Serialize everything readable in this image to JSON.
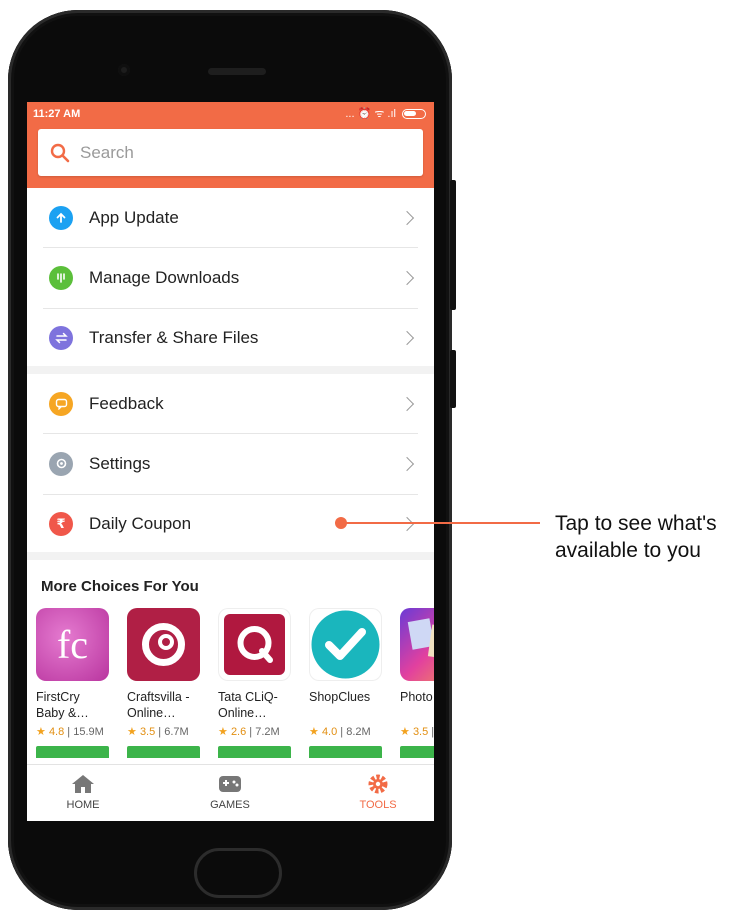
{
  "status_bar": {
    "time": "11:27 AM",
    "icons": "... ⏰ ᯤ .ıl"
  },
  "search": {
    "placeholder": "Search"
  },
  "menu_group_1": [
    {
      "label": "App Update",
      "icon": "arrow-up-icon",
      "color": "#1ba1f2"
    },
    {
      "label": "Manage Downloads",
      "icon": "download-icon",
      "color": "#5bbf3a"
    },
    {
      "label": "Transfer & Share Files",
      "icon": "transfer-icon",
      "color": "#7e73dd"
    }
  ],
  "menu_group_2": [
    {
      "label": "Feedback",
      "icon": "chat-icon",
      "color": "#f6a623"
    },
    {
      "label": "Settings",
      "icon": "gear-icon",
      "color": "#9aa5b1"
    },
    {
      "label": "Daily Coupon",
      "icon": "rupee-icon",
      "color": "#f0574a"
    }
  ],
  "more_choices": {
    "title": "More Choices For You",
    "apps": [
      {
        "name": "FirstCry\nBaby &…",
        "rating": "4.8",
        "size": "15.9M"
      },
      {
        "name": "Craftsvilla -\nOnline…",
        "rating": "3.5",
        "size": "6.7M"
      },
      {
        "name": "Tata CLiQ-\nOnline…",
        "rating": "2.6",
        "size": "7.2M"
      },
      {
        "name": "ShopClues",
        "rating": "4.0",
        "size": "8.2M"
      },
      {
        "name": "Photo",
        "rating": "3.5",
        "size": ""
      }
    ]
  },
  "tabs": [
    {
      "label": "HOME"
    },
    {
      "label": "GAMES"
    },
    {
      "label": "TOOLS"
    }
  ],
  "callout": {
    "text": "Tap to see what's\navailable to you"
  },
  "colors": {
    "accent": "#f26b46",
    "install": "#3cb44a"
  }
}
